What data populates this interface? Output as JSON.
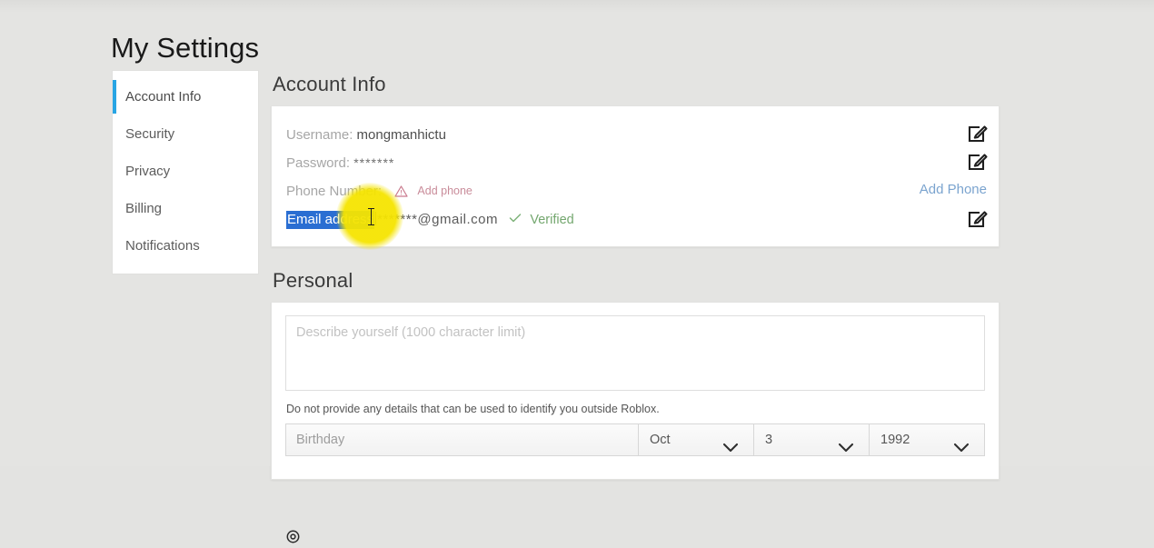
{
  "page": {
    "title": "My Settings"
  },
  "sidebar": {
    "items": [
      {
        "label": "Account Info",
        "active": true
      },
      {
        "label": "Security",
        "active": false
      },
      {
        "label": "Privacy",
        "active": false
      },
      {
        "label": "Billing",
        "active": false
      },
      {
        "label": "Notifications",
        "active": false
      }
    ]
  },
  "account_info": {
    "heading": "Account Info",
    "username_label": "Username:",
    "username_value": "mongmanhictu",
    "password_label": "Password:",
    "password_value": "*******",
    "phone_label": "Phone Number:",
    "add_phone_inline": "Add phone",
    "add_phone_button": "Add Phone",
    "email_label": "Email address",
    "email_value": "*******@gmail.com",
    "verified_label": "Verified",
    "edit_icon_name": "edit-icon"
  },
  "personal": {
    "heading": "Personal",
    "bio_placeholder": "Describe yourself (1000 character limit)",
    "bio_value": "",
    "hint": "Do not provide any details that can be used to identify you outside Roblox.",
    "birthday_placeholder": "Birthday",
    "month": "Oct",
    "day": "3",
    "year": "1992"
  },
  "colors": {
    "accent_blue": "#28a5e4",
    "selection_blue": "#2a6ed2",
    "link_blue": "#7ba4cf",
    "verified_green": "#74a76f",
    "warning_pink": "#c98c9a",
    "cursor_yellow": "#f5e400",
    "page_bg": "#e4e4e2"
  }
}
